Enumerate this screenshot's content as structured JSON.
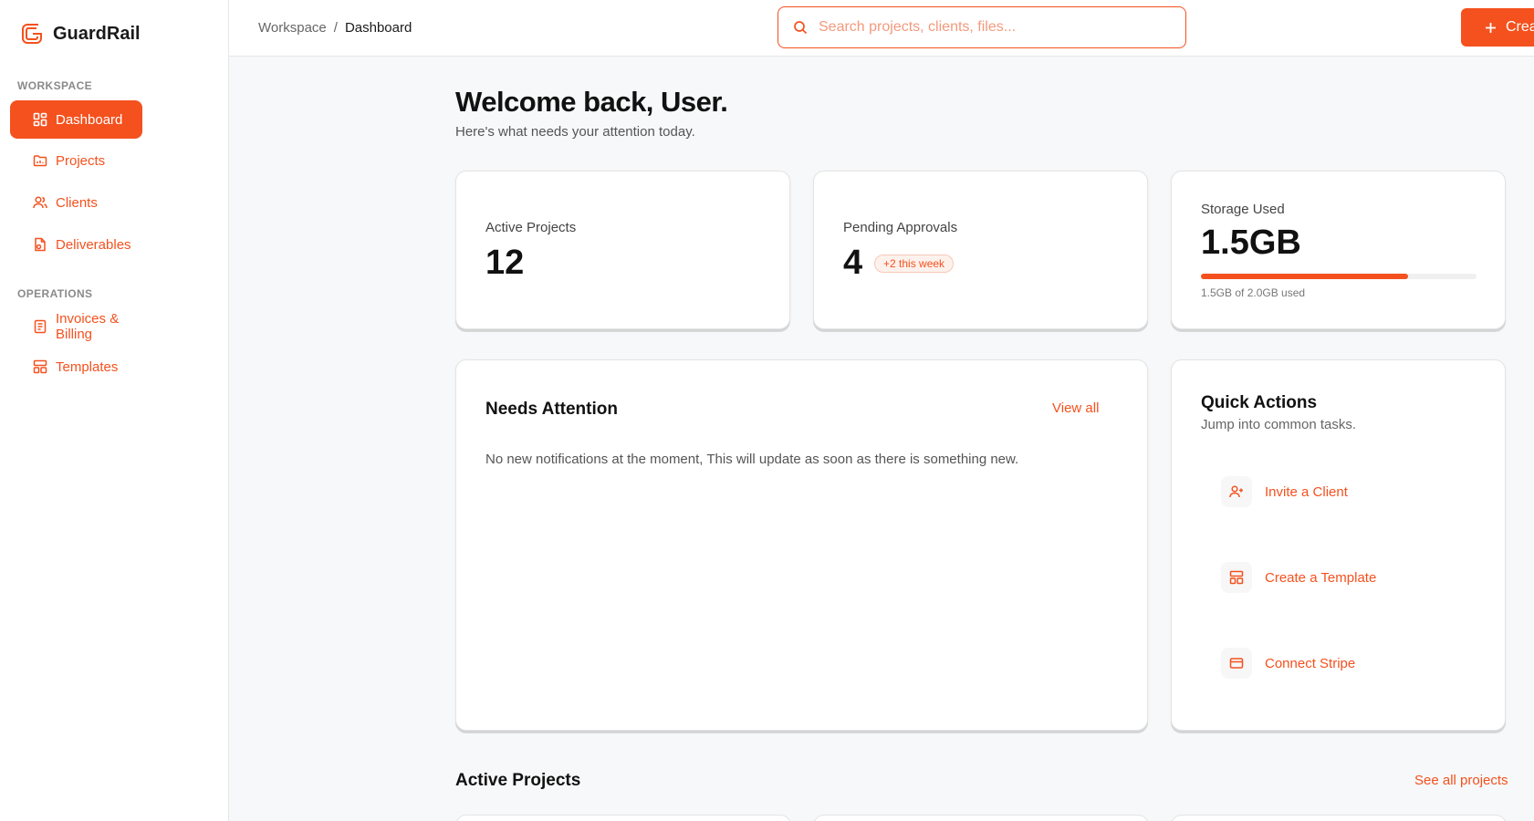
{
  "colors": {
    "accent": "#f4511e"
  },
  "brand": {
    "name": "GuardRail",
    "logo_icon": "guardrail-logo-icon"
  },
  "sidebar": {
    "sections": [
      {
        "label": "WORKSPACE"
      },
      {
        "label": "OPERATIONS"
      }
    ],
    "items": [
      {
        "label": "Dashboard",
        "icon": "dashboard-grid-icon",
        "active": true
      },
      {
        "label": "Projects",
        "icon": "folder-icon"
      },
      {
        "label": "Clients",
        "icon": "users-icon"
      },
      {
        "label": "Deliverables",
        "icon": "file-icon"
      },
      {
        "label": "Invoices & Billing",
        "icon": "invoice-icon"
      },
      {
        "label": "Templates",
        "icon": "template-icon"
      }
    ]
  },
  "topbar": {
    "breadcrumb": [
      "Workspace",
      "Dashboard"
    ],
    "breadcrumb_sep": "/",
    "search_placeholder": "Search projects, clients, files...",
    "create_label": "Create"
  },
  "welcome": {
    "title": "Welcome back, User.",
    "subtitle": "Here's what needs your attention today."
  },
  "stats": [
    {
      "label": "Active Projects",
      "value": "12"
    },
    {
      "label": "Pending Approvals",
      "value": "4",
      "badge": "+2 this week"
    },
    {
      "label": "Storage Used",
      "value": "1.5GB",
      "progress": 0.75,
      "note": "1.5GB of 2.0GB used"
    }
  ],
  "attention": {
    "title": "Needs Attention",
    "link": "View all",
    "empty_text": "No new notifications at the moment, This will update as soon as there is something new."
  },
  "quick_actions": {
    "title": "Quick Actions",
    "subtitle": "Jump into common tasks.",
    "items": [
      {
        "label": "Invite a Client",
        "icon": "user-plus-icon"
      },
      {
        "label": "Create a Template",
        "icon": "template-icon"
      },
      {
        "label": "Connect Stripe",
        "icon": "credit-card-icon"
      }
    ]
  },
  "active_projects": {
    "title": "Active Projects",
    "link": "See all projects"
  }
}
